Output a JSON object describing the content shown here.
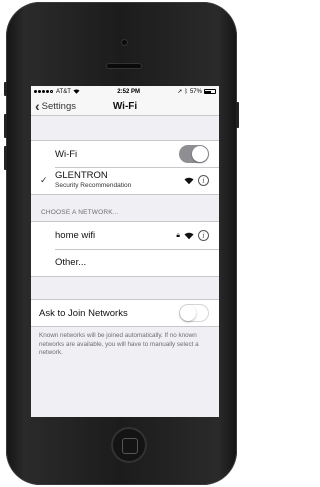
{
  "status_bar": {
    "carrier": "AT&T",
    "time": "2:52 PM",
    "battery_percent": "57%"
  },
  "nav": {
    "back_label": "Settings",
    "title": "Wi-Fi"
  },
  "wifi_toggle": {
    "label": "Wi-Fi",
    "state": "on"
  },
  "connected_network": {
    "name": "GLENTRON",
    "subtitle": "Security Recommendation",
    "checkmark": "✓"
  },
  "networks_section": {
    "header": "CHOOSE A NETWORK...",
    "items": [
      {
        "name": "home wifi",
        "secured": true
      }
    ],
    "other_label": "Other..."
  },
  "ask_to_join": {
    "label": "Ask to Join Networks",
    "state": "off",
    "description": "Known networks will be joined automatically. If no known networks are available, you will have to manually select a network."
  },
  "colors": {
    "screen_bg": "#efeff4",
    "toggle_on": "#8e8e93",
    "separator": "#c8c7cc",
    "section_text": "#6d6d72"
  }
}
